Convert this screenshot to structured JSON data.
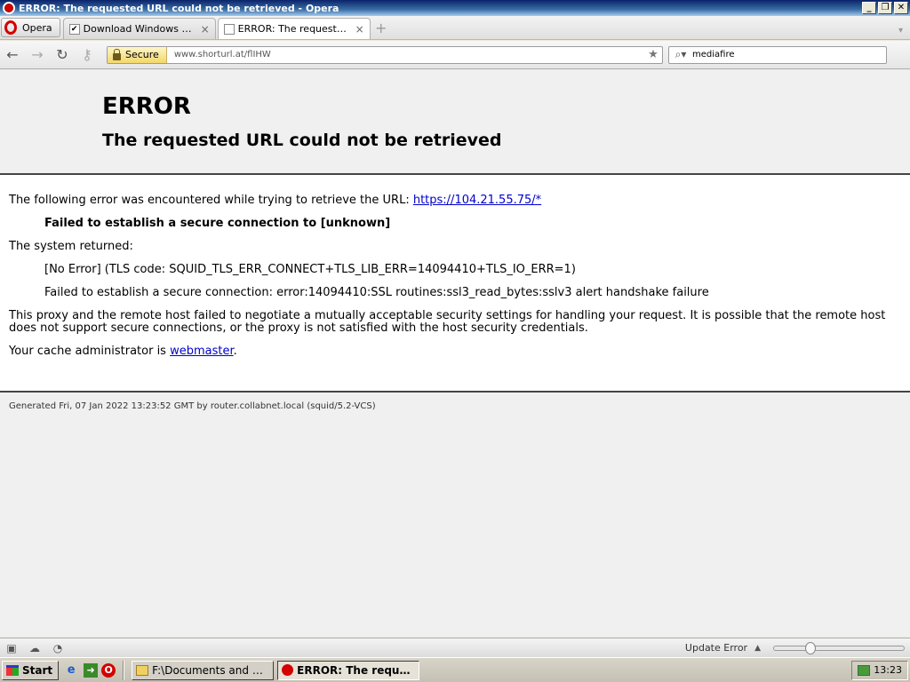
{
  "window": {
    "title": "ERROR: The requested URL could not be retrieved - Opera"
  },
  "tabbar": {
    "menu_label": "Opera",
    "tabs": [
      {
        "label": "Download Windows Vista...",
        "active": false
      },
      {
        "label": "ERROR: The requested ...",
        "active": true
      }
    ]
  },
  "navbar": {
    "secure_label": "Secure",
    "url": "www.shorturl.at/flIHW",
    "search_value": "mediafire"
  },
  "page": {
    "heading": "ERROR",
    "subheading": "The requested URL could not be retrieved",
    "intro_text": "The following error was encountered while trying to retrieve the URL: ",
    "intro_link": "https://104.21.55.75/*",
    "failure_title": "Failed to establish a secure connection to [unknown]",
    "system_returned": "The system returned:",
    "tls_code": "[No Error] (TLS code: SQUID_TLS_ERR_CONNECT+TLS_LIB_ERR=14094410+TLS_IO_ERR=1)",
    "ssl_error": "Failed to establish a secure connection: error:14094410:SSL routines:ssl3_read_bytes:sslv3 alert handshake failure",
    "explanation": "This proxy and the remote host failed to negotiate a mutually acceptable security settings for handling your request. It is possible that the remote host does not support secure connections, or the proxy is not satisfied with the host security credentials.",
    "admin_prefix": "Your cache administrator is ",
    "admin_link": "webmaster",
    "admin_suffix": ".",
    "footer": "Generated Fri, 07 Jan 2022 13:23:52 GMT by router.collabnet.local (squid/5.2-VCS)"
  },
  "statusbar": {
    "update_label": "Update Error",
    "zoom_fraction": 0.28
  },
  "taskbar": {
    "start_label": "Start",
    "buttons": [
      {
        "label": "F:\\Documents and Settin...",
        "active": false
      },
      {
        "label": "ERROR: The requeste...",
        "active": true
      }
    ],
    "clock": "13:23"
  }
}
